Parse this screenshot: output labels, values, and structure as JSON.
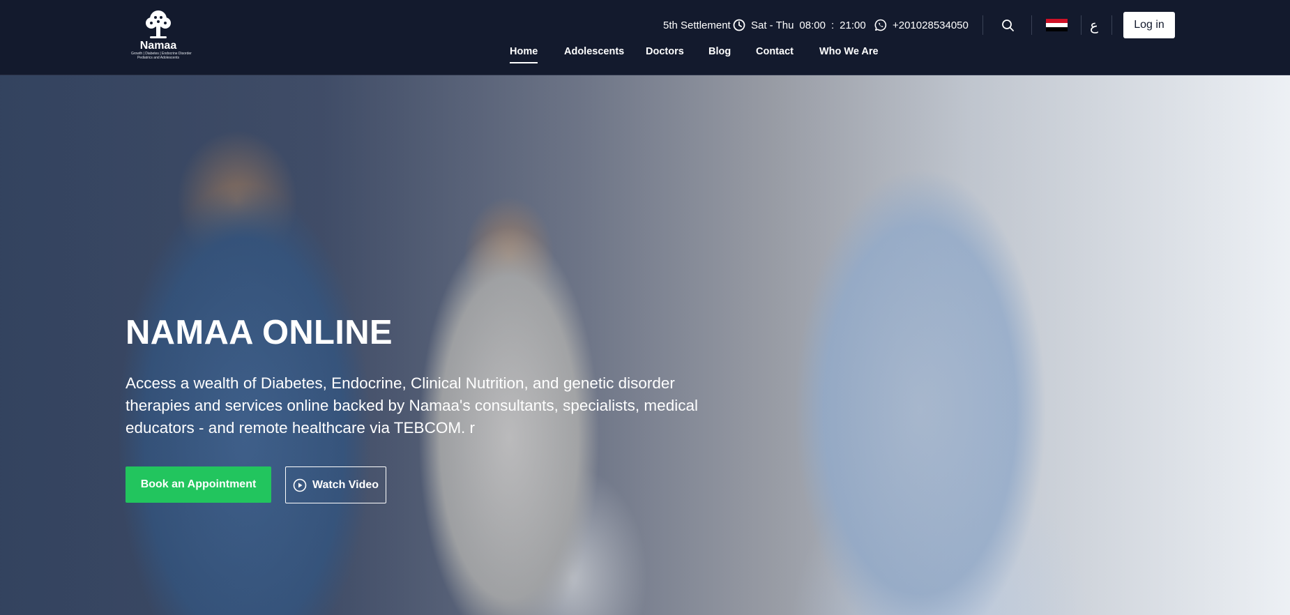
{
  "brand": {
    "logo_text": "Namaa",
    "logo_tagline": "Growth | Diabetes | Endocrine Disorder",
    "logo_tagline2": "Pediatrics and Adolescents"
  },
  "topbar": {
    "location": "5th Settlement",
    "hours_days": "Sat - Thu",
    "hours_open": "08:00",
    "hours_sep": ":",
    "hours_close": "21:00",
    "phone": "+201028534050",
    "lang_toggle": "ع",
    "login_label": "Log in",
    "flag_colors": [
      "#ce1126",
      "#ffffff",
      "#000000"
    ]
  },
  "nav": {
    "items": [
      "Home",
      "Adolescents",
      "Doctors",
      "Blog",
      "Contact",
      "Who We Are"
    ],
    "active": "Home"
  },
  "hero": {
    "title": "NAMAA ONLINE",
    "text": "Access a wealth of Diabetes, Endocrine, Clinical Nutrition, and genetic disorder therapies and services online backed by Namaa's consultants, specialists, medical educators - and remote healthcare via TEBCOM. r",
    "primary_cta": "Book an Appointment",
    "secondary_cta": "Watch Video"
  },
  "icons": {
    "clock": "clock-icon",
    "whatsapp": "whatsapp-icon",
    "search": "search-icon",
    "flag": "egypt-flag-icon",
    "play": "play-circle-icon"
  },
  "colors": {
    "header_bg": "#131a2d",
    "primary_button": "#22c55e",
    "text_light": "#ffffff"
  }
}
